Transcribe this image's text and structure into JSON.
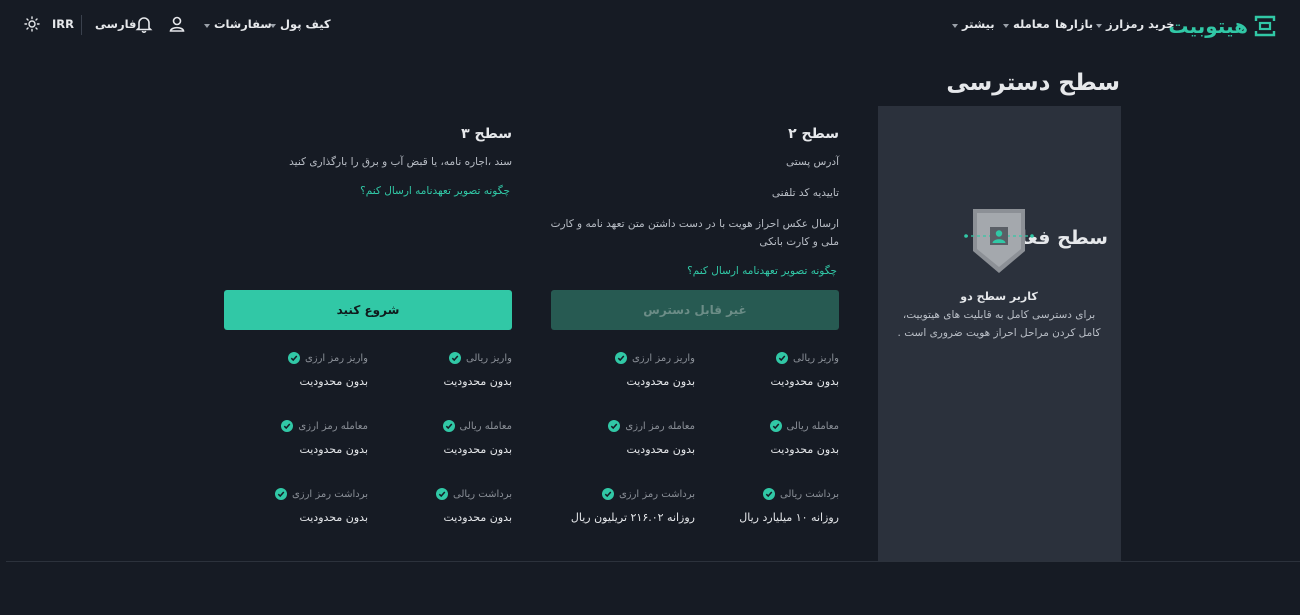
{
  "header": {
    "logo_text": "هیتوبیت",
    "nav": {
      "buy_crypto": "خرید رمزارز",
      "markets": "بازارها",
      "trade": "معامله",
      "more": "بیشتر",
      "wallet": "کیف پول",
      "orders": "سفارشات",
      "language": "فارسی",
      "currency": "IRR"
    }
  },
  "page_title": "سطح دسترسی",
  "current": {
    "title": "سطح فعلی",
    "user_level": "کاربر سطح دو",
    "description": "برای دسترسی کامل به قابلیت های هیتوبیت، کامل کردن مراحل احراز هویت ضروری است ."
  },
  "level2": {
    "title": "سطح ۲",
    "req1": "آدرس پستی",
    "req2": "تاییدیه کد تلفنی",
    "req3": "ارسال عکس احراز هویت با در دست داشتن متن تعهد نامه و کارت ملی و کارت بانکی",
    "link": "چگونه تصویر تعهدنامه ارسال کنم؟",
    "button": "غیر قابل دسترس",
    "features": [
      {
        "label": "واریز ریالی",
        "value": "بدون محدودیت"
      },
      {
        "label": "واریز رمز ارزی",
        "value": "بدون محدودیت"
      },
      {
        "label": "معامله ریالی",
        "value": "بدون محدودیت"
      },
      {
        "label": "معامله رمز ارزی",
        "value": "بدون محدودیت"
      },
      {
        "label": "برداشت ریالی",
        "value": "روزانه ۱۰ میلیارد ریال"
      },
      {
        "label": "برداشت رمز ارزی",
        "value": "روزانه ۲۱۶.۰۲ تریلیون ریال"
      }
    ]
  },
  "level3": {
    "title": "سطح ۳",
    "req1": "سند ،اجاره نامه، یا قبض آب و برق را بارگذاری کنید",
    "link": "چگونه تصویر تعهدنامه ارسال کنم؟",
    "button": "شروع کنید",
    "features": [
      {
        "label": "واریز ریالی",
        "value": "بدون محدودیت"
      },
      {
        "label": "واریز رمز ارزی",
        "value": "بدون محدودیت"
      },
      {
        "label": "معامله ریالی",
        "value": "بدون محدودیت"
      },
      {
        "label": "معامله رمز ارزی",
        "value": "بدون محدودیت"
      },
      {
        "label": "برداشت ریالی",
        "value": "بدون محدودیت"
      },
      {
        "label": "برداشت رمز ارزی",
        "value": "بدون محدودیت"
      }
    ]
  },
  "colors": {
    "accent": "#31c8a6",
    "background": "#161b24",
    "panel": "#2b313c",
    "disabled_button": "#275a52"
  }
}
